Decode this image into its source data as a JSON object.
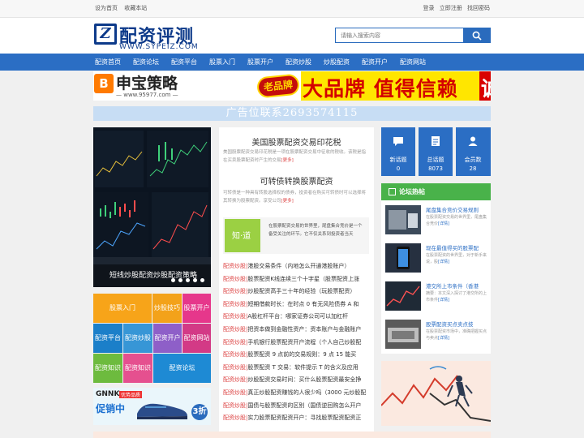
{
  "topbar": {
    "left": [
      "设为首页",
      "收藏本站"
    ],
    "right": [
      "登录",
      "立即注册",
      "找回密码"
    ]
  },
  "logo": {
    "name": "配资评测",
    "url": "WWW.SYPEIZ.COM"
  },
  "search": {
    "placeholder": "请输入搜索内容"
  },
  "nav": [
    "配资首页",
    "配资论坛",
    "配资平台",
    "股票入门",
    "股票开户",
    "配资炒股",
    "炒股配资",
    "配资开户",
    "配资网站"
  ],
  "banner1": {
    "brand": "申宝策略",
    "brand_url": "— www.95977.com —",
    "badge": "老品牌",
    "slogan": "大品牌 值得信赖",
    "recruit": "诚招代理"
  },
  "banner2": {
    "text": "广告位联系2693574115"
  },
  "slider": {
    "caption": "短线炒股配资炒股配资策略"
  },
  "tiles": [
    "股票入门",
    "炒股技巧",
    "股票开户",
    "配资平台",
    "配资炒股",
    "配资开户",
    "配资网站",
    "配资知识",
    "配资论坛"
  ],
  "side_ad": {
    "brand": "GNNK",
    "tag": "优势品质",
    "promo": "促销中",
    "price": "3折"
  },
  "articles": [
    {
      "title": "美国股票配资交易印花税",
      "desc": "美国股票配资交易印花税是一项在股票配资交易中征收的税收。该税是指在买卖股票配资时产生的交易",
      "more": "[更多]"
    },
    {
      "title": "可转债转换股票配资",
      "desc": "可转债是一种具有转股选择权的债券，投资者在购买可转债时可以选择将其转换为股票配资。享受公司",
      "more": "[更多]"
    }
  ],
  "infobox": {
    "icon_text": "知·道",
    "text": "在股票配资交易的世界里，尾盘集合竞价是一个备受关注的环节。它不仅关系到投资者当天"
  },
  "list": [
    {
      "tag": "配资炒股|",
      "text": "港股交易条件（内地怎么开通港股账户）"
    },
    {
      "tag": "配资炒股|",
      "text": "股票配资K线连续三个十字星（股票配资上涨"
    },
    {
      "tag": "配资炒股|",
      "text": "炒股配资高手三十年的经验（玩股票配资）"
    },
    {
      "tag": "配资炒股|",
      "text": "短期借款时长：在时点 0 有无风险债券 A 和"
    },
    {
      "tag": "配资炒股|",
      "text": "A股杠杆平台：哪家证券公司可以加杠杆"
    },
    {
      "tag": "配资炒股|",
      "text": "把资本做到金融性资产：资本账户与金融账户"
    },
    {
      "tag": "配资炒股|",
      "text": "手机银行股票配资开户流程（个人自己炒股配"
    },
    {
      "tag": "配资炒股|",
      "text": "股票配资 9 点前的交易规则：9 点 15 能买"
    },
    {
      "tag": "配资炒股|",
      "text": "股票配资 T 交易：软件提示 T 的含义及应用"
    },
    {
      "tag": "配资炒股|",
      "text": "炒股配资交易时间：买什么股票配资最安全挣"
    },
    {
      "tag": "配资炒股|",
      "text": "真正炒股配资赚钱的人很少吗（3000 元炒股配"
    },
    {
      "tag": "配资炒股|",
      "text": "国债与股票配资的区别（国债逆回购怎么开户"
    },
    {
      "tag": "配资炒股|",
      "text": "实力股票配资配资开户：寻找股票配资配资正"
    }
  ],
  "stats": [
    {
      "label": "新话题",
      "value": "0",
      "icon": "chat-icon"
    },
    {
      "label": "总话题",
      "value": "8073",
      "icon": "document-icon"
    },
    {
      "label": "会员数",
      "value": "28",
      "icon": "user-icon"
    }
  ],
  "hot": {
    "title": "论坛热帖",
    "items": [
      {
        "title": "尾盘集合竞价交易规则",
        "desc": "在股票配资交易的世界里，尾盘集合竞价",
        "more": "[详情]"
      },
      {
        "title": "现在最值得买的股票配",
        "desc": "在股票配资的世界里，对于新手来说，股",
        "more": "[详情]"
      },
      {
        "title": "港交所上市条件（香港",
        "desc": "摘要：本文深入探讨了港交所的上市条件",
        "more": "[详情]"
      },
      {
        "title": "股票配资买点卖点技",
        "desc": "在股票配资市场中，准确把握买点与卖点",
        "more": "[详情]"
      }
    ]
  },
  "colors": {
    "nav": "#2b6ec4",
    "hot_header": "#49b24a",
    "accent_red": "#d44"
  }
}
